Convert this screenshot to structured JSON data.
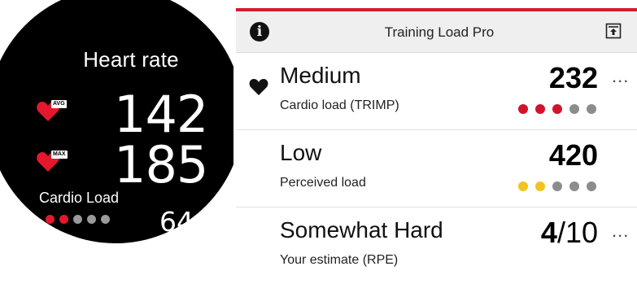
{
  "watch": {
    "title": "Heart rate",
    "avg_tag": "AVG",
    "avg_value": "142",
    "max_tag": "MAX",
    "max_value": "185",
    "cardio_label": "Cardio Load",
    "cardio_value": "64",
    "cardio_level": 2,
    "cardio_level_max": 5,
    "active_dot_color": "#e3182d",
    "inactive_dot_color": "#9a9a9a",
    "heart_icon": "heart-icon"
  },
  "app": {
    "title": "Training Load Pro",
    "info_icon": "info-icon",
    "export_icon": "export-icon",
    "accent_color": "#d9192f",
    "rows": [
      {
        "level": "Medium",
        "description": "Cardio load (TRIMP)",
        "value": "232",
        "dots_filled": 3,
        "dots_total": 5,
        "fill_color": "#d0142c",
        "empty_color": "#8c8c8c",
        "more": "...",
        "icon": "heart-icon"
      },
      {
        "level": "Low",
        "description": "Perceived load",
        "value": "420",
        "dots_filled": 2,
        "dots_total": 5,
        "fill_color": "#f2c41d",
        "empty_color": "#8c8c8c"
      },
      {
        "level": "Somewhat Hard",
        "description": "Your estimate (RPE)",
        "value_num": "4",
        "value_den": "/10",
        "more": "..."
      }
    ]
  }
}
